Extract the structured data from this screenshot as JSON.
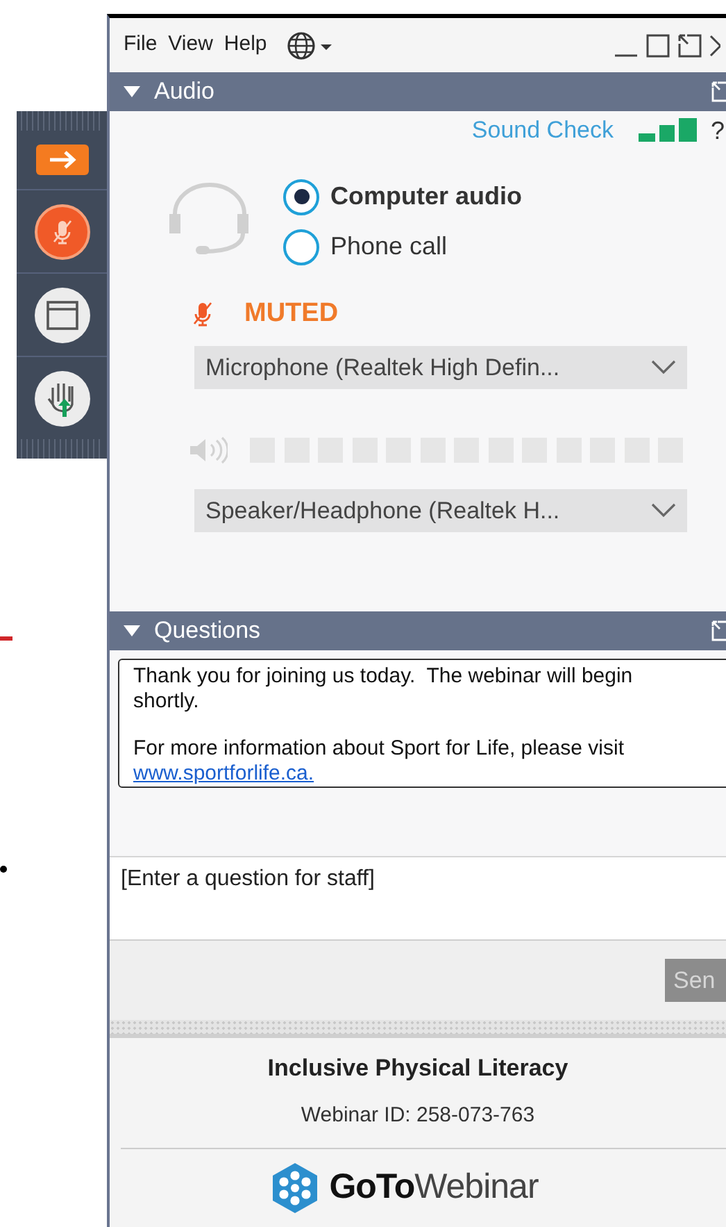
{
  "toolbar": [
    {
      "kind": "arrow"
    },
    {
      "kind": "mic",
      "muted": true
    },
    {
      "kind": "window"
    },
    {
      "kind": "hand"
    }
  ],
  "menu": [
    {
      "label": "File"
    },
    {
      "label": "View"
    },
    {
      "label": "Help"
    }
  ],
  "audio": {
    "title": "Audio",
    "expanded": true,
    "sound_check": "Sound Check",
    "help": "?",
    "options": [
      {
        "label": "Computer audio",
        "selected": true
      },
      {
        "label": "Phone call",
        "selected": false
      }
    ],
    "muted": true,
    "mute_status": "MUTED",
    "microphone": "Microphone (Realtek High Defin...",
    "speaker": "Speaker/Headphone  (Realtek H..."
  },
  "questions": {
    "title": "Questions",
    "expanded": true,
    "messages": [
      {
        "text": "Thank you for joining us today.  The webinar will begin shortly."
      },
      {
        "text": "For more information about Sport for Life, please visit",
        "link": "www.sportforlife.ca."
      }
    ],
    "placeholder": "[Enter a question for staff]",
    "send": "Sen"
  },
  "footer": {
    "webinar_title": "Inclusive Physical Literacy",
    "webinar_id": "Webinar ID: 258-073-763",
    "logo_bold": "GoTo",
    "logo_light": "Webinar"
  }
}
